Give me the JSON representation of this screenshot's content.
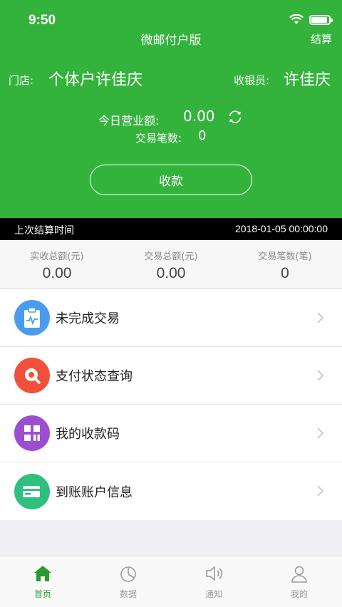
{
  "status_bar": {
    "time": "9:50"
  },
  "header": {
    "title": "微邮付户版",
    "settle_label": "结算",
    "store_label": "门店:",
    "store_name": "个体户许佳庆",
    "cashier_label": "收银员:",
    "cashier_name": "许佳庆",
    "today_revenue_label": "今日营业额:",
    "today_revenue_value": "0.00",
    "transaction_count_label": "交易笔数:",
    "transaction_count_value": "0",
    "collect_button": "收款"
  },
  "last_settlement": {
    "label": "上次结算时间",
    "time": "2018-01-05 00:00:00"
  },
  "summary": [
    {
      "label": "实收总额(元)",
      "value": "0.00"
    },
    {
      "label": "交易总额(元)",
      "value": "0.00"
    },
    {
      "label": "交易笔数(笔)",
      "value": "0"
    }
  ],
  "menu": [
    {
      "label": "未完成交易",
      "icon": "clipboard-icon",
      "color": "#4a9cf0"
    },
    {
      "label": "支付状态查询",
      "icon": "search-query-icon",
      "color": "#f0513a"
    },
    {
      "label": "我的收款码",
      "icon": "qr-code-icon",
      "color": "#9b4fd0"
    },
    {
      "label": "到账账户信息",
      "icon": "card-icon",
      "color": "#2fbf7e"
    }
  ],
  "tabs": [
    {
      "label": "首页",
      "icon": "home-icon",
      "active": true
    },
    {
      "label": "数据",
      "icon": "pie-chart-icon",
      "active": false
    },
    {
      "label": "通知",
      "icon": "speaker-icon",
      "active": false
    },
    {
      "label": "我的",
      "icon": "user-icon",
      "active": false
    }
  ],
  "colors": {
    "brand_green": "#33b33b",
    "active_tab": "#2a9a30"
  }
}
